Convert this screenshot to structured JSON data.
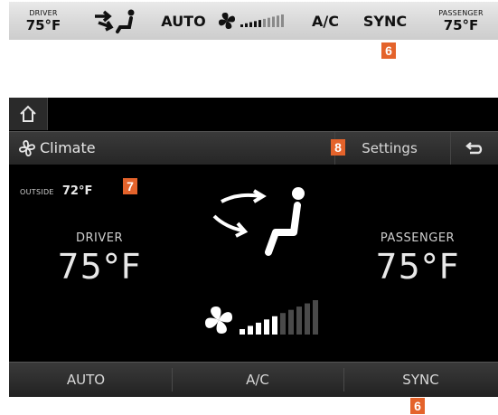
{
  "strip": {
    "driver_label": "DRIVER",
    "driver_temp": "75°F",
    "auto": "AUTO",
    "ac": "A/C",
    "sync": "SYNC",
    "passenger_label": "PASSENGER",
    "passenger_temp": "75°F",
    "fan_level": 5,
    "fan_levels_total": 10
  },
  "callouts": {
    "sync_top": "6",
    "settings": "8",
    "outside": "7",
    "sync_bottom": "6"
  },
  "screen": {
    "title": "Climate",
    "settings": "Settings",
    "outside_label": "OUTSIDE",
    "outside_temp": "72°F",
    "driver_label": "DRIVER",
    "driver_temp": "75°F",
    "passenger_label": "PASSENGER",
    "passenger_temp": "75°F",
    "fan_level": 5,
    "fan_levels_total": 10,
    "bottom": {
      "auto": "AUTO",
      "ac": "A/C",
      "sync": "SYNC"
    }
  },
  "colors": {
    "callout": "#e4632b",
    "screen_bg": "#000000"
  },
  "icons": [
    "airflow-seat-icon",
    "fan-icon",
    "home-icon",
    "climate-fan-icon",
    "back-icon"
  ]
}
